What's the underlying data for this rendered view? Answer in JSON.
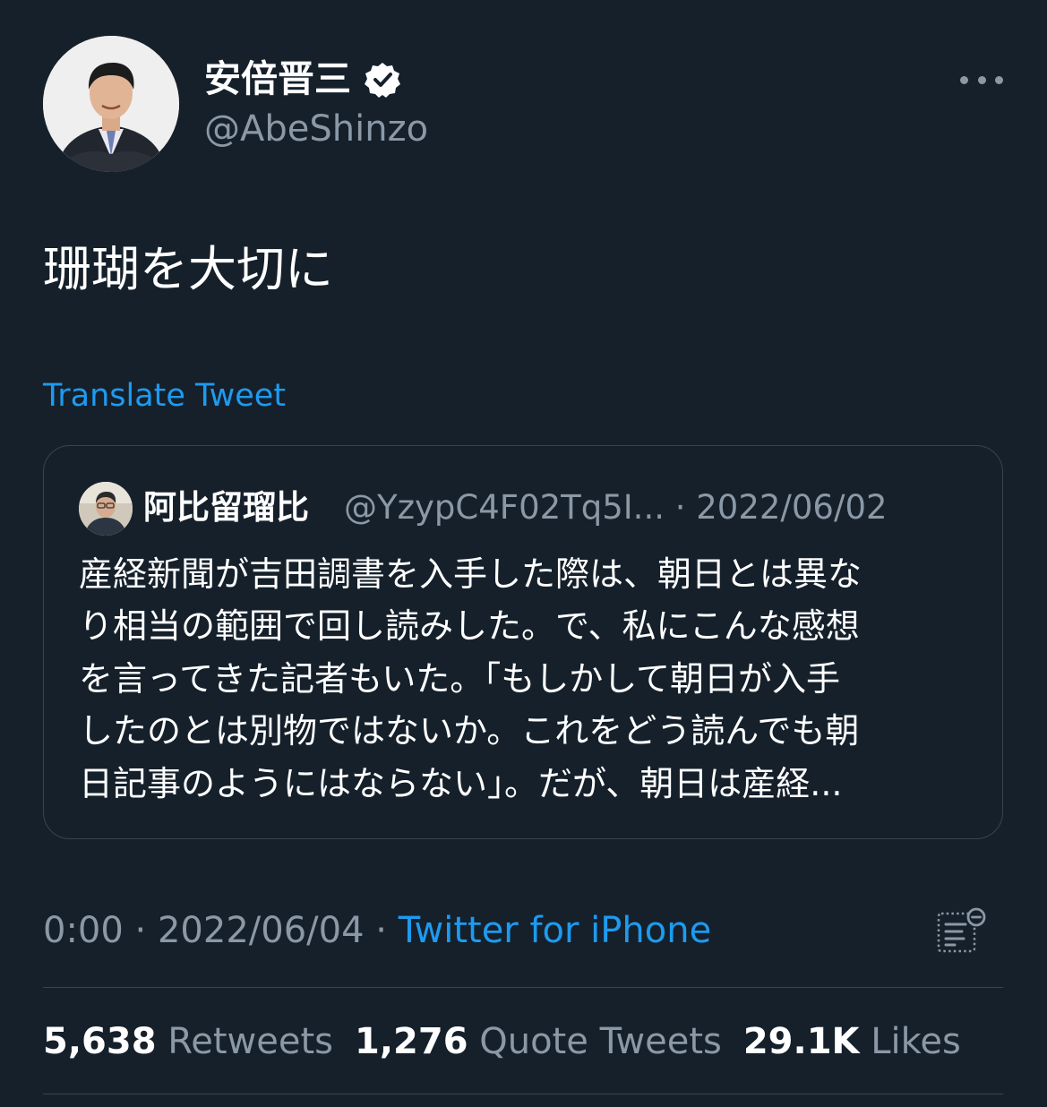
{
  "tweet": {
    "author": {
      "display_name": "安倍晋三",
      "handle": "@AbeShinzo",
      "verified": true,
      "avatar_icon": "profile-photo"
    },
    "text": "珊瑚を大切に",
    "translate_label": "Translate Tweet",
    "quoted": {
      "display_name": "阿比留瑠比",
      "handle": "@YzypC4F02Tq5I...",
      "separator": "·",
      "date": "2022/06/02",
      "lines": [
        "産経新聞が吉田調書を入手した際は、朝日とは異な",
        "り相当の範囲で回し読みした。で、私にこんな感想",
        "を言ってきた記者もいた。「もしかして朝日が入手",
        "したのとは別物ではないか。これをどう読んでも朝",
        "日記事のようにはならない」。だが、朝日は産経..."
      ]
    },
    "meta": {
      "time": "0:00",
      "sep1": " · ",
      "date": "2022/06/04",
      "sep2": " · ",
      "source": "Twitter for iPhone"
    },
    "stats": {
      "retweets": {
        "count": "5,638",
        "label": "Retweets"
      },
      "quotes": {
        "count": "1,276",
        "label": "Quote Tweets"
      },
      "likes": {
        "count": "29.1K",
        "label": "Likes"
      }
    }
  },
  "colors": {
    "background": "#15202b",
    "accent": "#1d9bf0",
    "secondary_text": "#8b98a5",
    "border": "#38444d"
  }
}
